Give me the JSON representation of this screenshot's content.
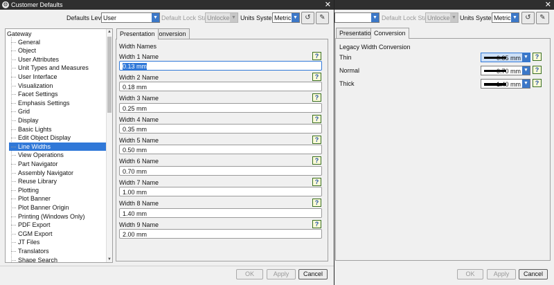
{
  "window_left": {
    "title": "Customer Defaults",
    "defaults_level_label": "Defaults Level",
    "defaults_level_value": "User",
    "lock_state_label": "Default Lock State",
    "lock_state_value": "Unlocked",
    "units_label": "Units System",
    "units_value": "Metric",
    "tree_root": "Gateway",
    "tree_items": [
      "General",
      "Object",
      "User Attributes",
      "Unit Types and Measures",
      "User Interface",
      "Visualization",
      "Facet Settings",
      "Emphasis Settings",
      "Grid",
      "Display",
      "Basic Lights",
      "Edit Object Display",
      "Line Widths",
      "View Operations",
      "Part Navigator",
      "Assembly Navigator",
      "Reuse Library",
      "Plotting",
      "Plot Banner",
      "Plot Banner Origin",
      "Printing (Windows Only)",
      "PDF Export",
      "CGM Export",
      "JT Files",
      "Translators",
      "Shape Search"
    ],
    "selected_item": "Line Widths",
    "tabs": [
      "Presentation",
      "Conversion"
    ],
    "active_tab": "Presentation",
    "section_title": "Width Names",
    "width_fields": [
      {
        "label": "Width 1 Name",
        "value": "0.13 mm"
      },
      {
        "label": "Width 2 Name",
        "value": "0.18 mm"
      },
      {
        "label": "Width 3 Name",
        "value": "0.25 mm"
      },
      {
        "label": "Width 4 Name",
        "value": "0.35 mm"
      },
      {
        "label": "Width 5 Name",
        "value": "0.50 mm"
      },
      {
        "label": "Width 6 Name",
        "value": "0.70 mm"
      },
      {
        "label": "Width 7 Name",
        "value": "1.00 mm"
      },
      {
        "label": "Width 8 Name",
        "value": "1.40 mm"
      },
      {
        "label": "Width 9 Name",
        "value": "2.00 mm"
      }
    ],
    "buttons": {
      "ok": "OK",
      "apply": "Apply",
      "cancel": "Cancel"
    }
  },
  "window_right": {
    "lock_state_label": "Default Lock State",
    "lock_state_value": "Unlocked",
    "units_label": "Units System",
    "units_value": "Metric",
    "tabs": [
      "Presentation",
      "Conversion"
    ],
    "active_tab": "Conversion",
    "section_title": "Legacy Width Conversion",
    "conversions": [
      {
        "label": "Thin",
        "value": "0.35 mm"
      },
      {
        "label": "Normal",
        "value": "0.70 mm"
      },
      {
        "label": "Thick",
        "value": "1.40 mm"
      }
    ],
    "buttons": {
      "ok": "OK",
      "apply": "Apply",
      "cancel": "Cancel"
    }
  },
  "colors": {
    "accent": "#3078d8",
    "titlebar": "#2f2f2f"
  },
  "icons": [
    "gear-icon",
    "close-icon",
    "chevron-down-icon",
    "help-icon",
    "reset-icon",
    "lock-icon"
  ]
}
